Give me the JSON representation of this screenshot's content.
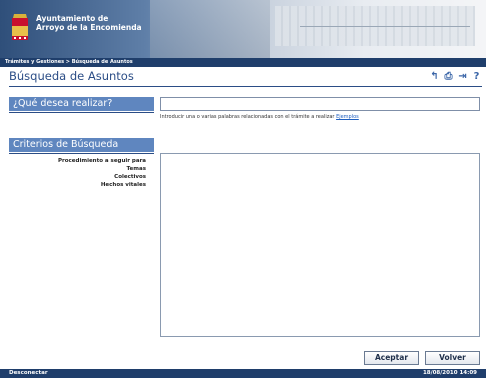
{
  "header": {
    "org_line1": "Ayuntamiento de",
    "org_line2": "Arroyo de la Encomienda"
  },
  "breadcrumb": "Trámites y Gestiones > Búsqueda de Asuntos",
  "page": {
    "title": "Búsqueda de Asuntos"
  },
  "toolbar": {
    "icons": [
      "undo-icon",
      "print-icon",
      "exit-icon",
      "help-icon"
    ]
  },
  "search_section": {
    "heading": "¿Qué desea realizar?",
    "input_value": "",
    "help_text": "Introducir una o varias palabras relacionadas con el trámite a realizar",
    "examples_link": "Ejemplos"
  },
  "criteria_section": {
    "heading": "Criterios de Búsqueda",
    "items": [
      "Procedimiento a seguir para",
      "Temas",
      "Colectivos",
      "Hechos vitales"
    ]
  },
  "buttons": {
    "accept": "Aceptar",
    "back": "Volver"
  },
  "footer": {
    "logout": "Desconectar",
    "datetime": "18/08/2010 14:09"
  }
}
